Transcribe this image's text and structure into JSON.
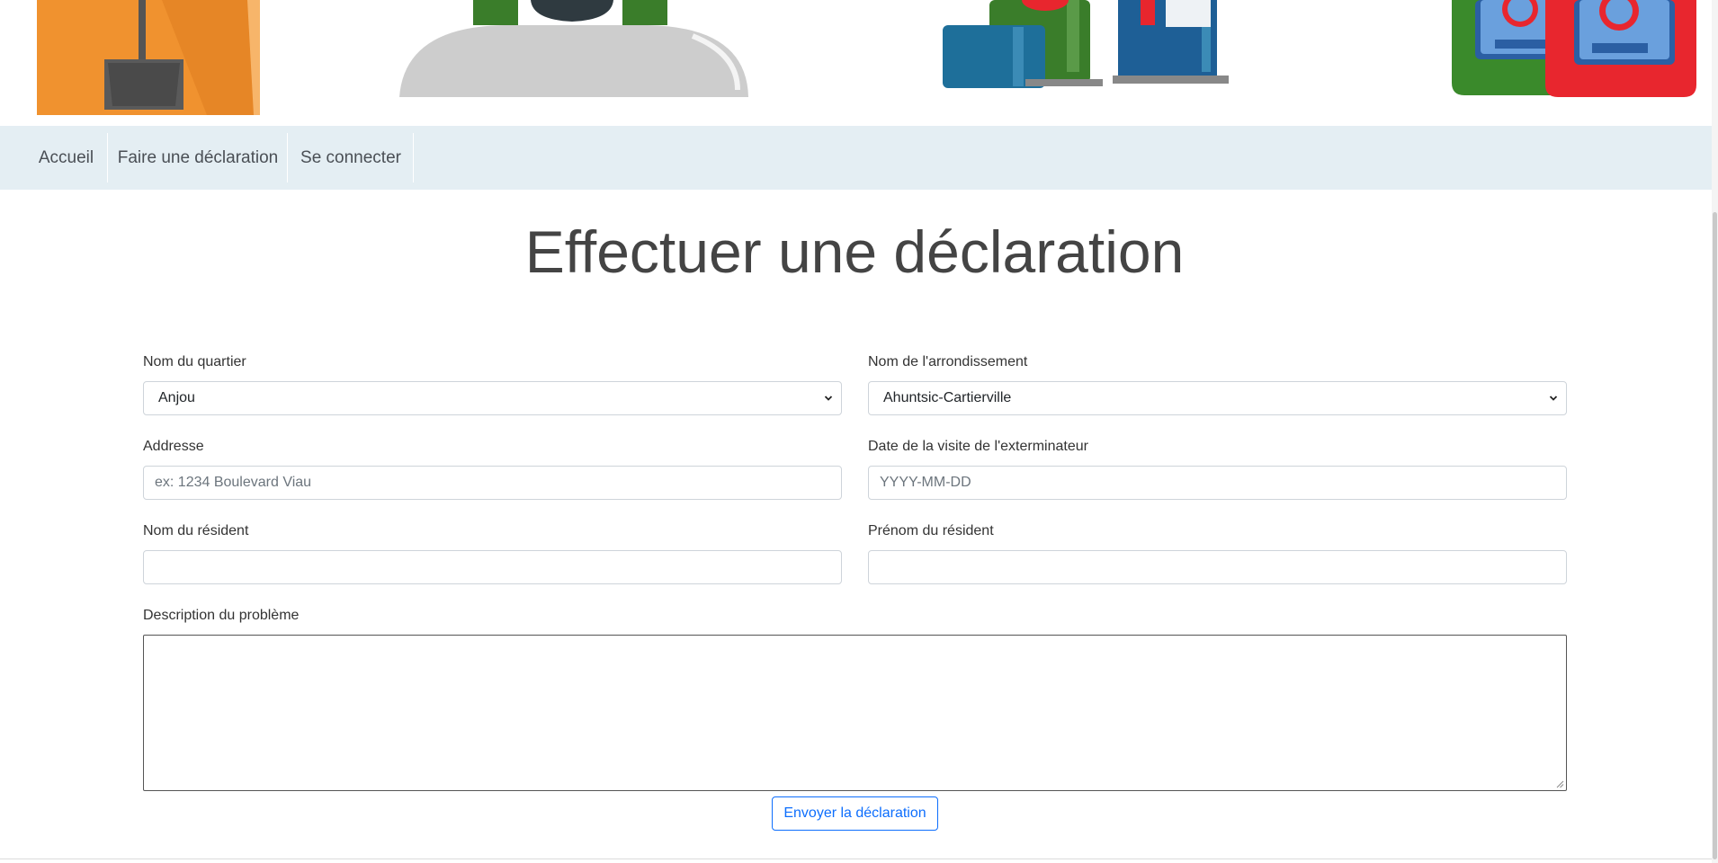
{
  "nav": {
    "items": [
      "Accueil",
      "Faire une déclaration",
      "Se connecter"
    ]
  },
  "page": {
    "title": "Effectuer une déclaration"
  },
  "form": {
    "quartier": {
      "label": "Nom du quartier",
      "value": "Anjou"
    },
    "arrondissement": {
      "label": "Nom de l'arrondissement",
      "value": "Ahuntsic-Cartierville"
    },
    "adresse": {
      "label": "Addresse",
      "placeholder": "ex: 1234 Boulevard Viau"
    },
    "date_visite": {
      "label": "Date de la visite de l'exterminateur",
      "placeholder": "YYYY-MM-DD"
    },
    "nom_resident": {
      "label": "Nom du résident",
      "value": ""
    },
    "prenom_resident": {
      "label": "Prénom du résident",
      "value": ""
    },
    "description": {
      "label": "Description du problème",
      "value": ""
    },
    "submit_label": "Envoyer la déclaration"
  },
  "colors": {
    "nav_bg": "#e4eef3",
    "button_accent": "#0d6efd"
  }
}
